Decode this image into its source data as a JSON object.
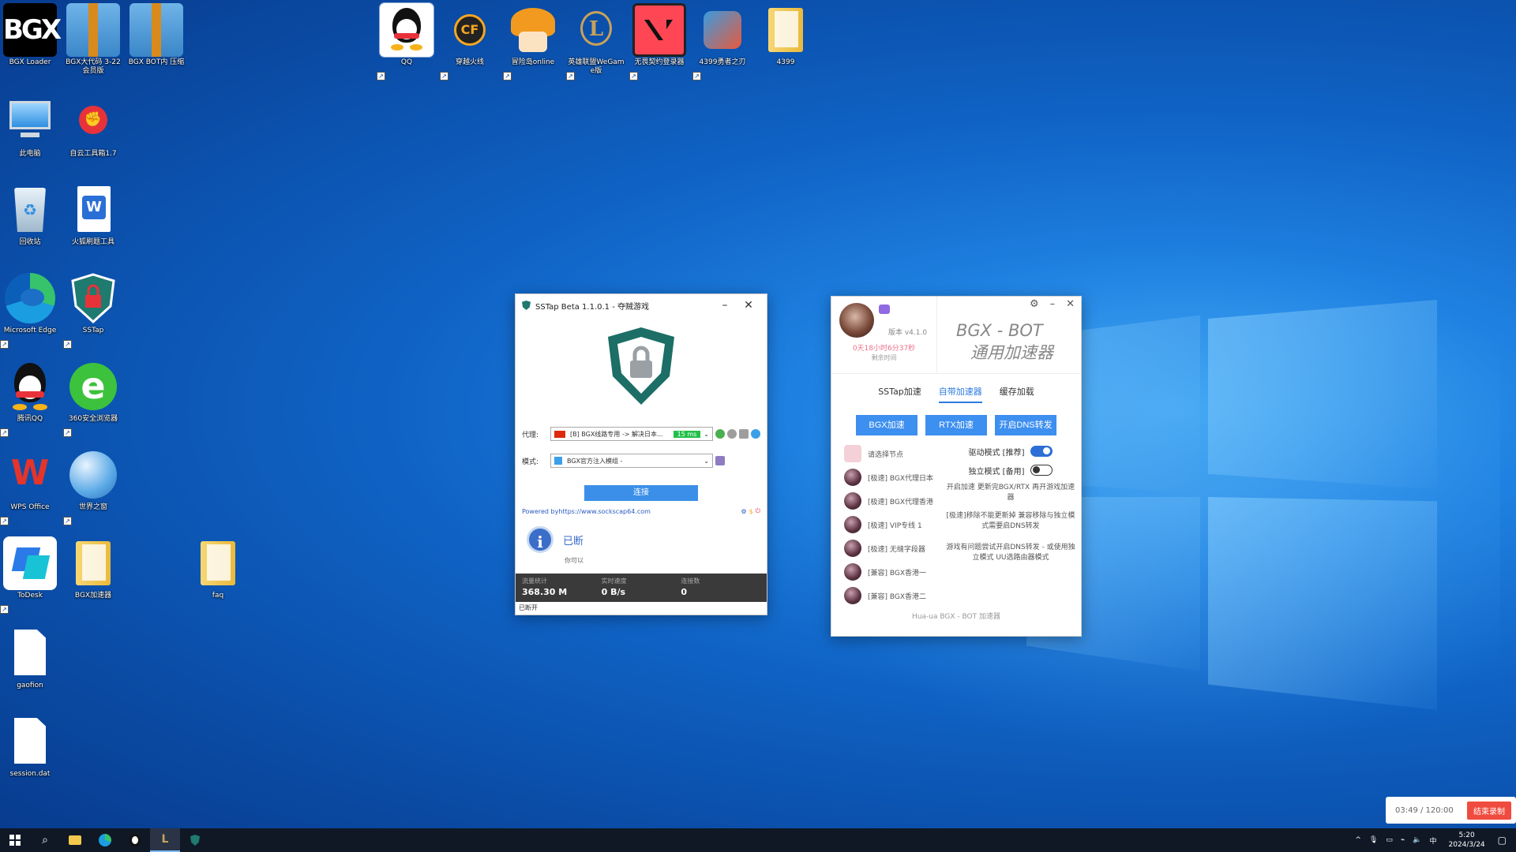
{
  "desktop_icons": [
    {
      "id": "bgx-loader",
      "label": "BGX Loader"
    },
    {
      "id": "bgx-zip1",
      "label": "BGX大代码 3-22 会员版"
    },
    {
      "id": "bgx-zip2",
      "label": "BGX BOT内 压缩"
    },
    {
      "id": "this-pc",
      "label": "此电脑"
    },
    {
      "id": "riot",
      "label": "自云工具箱1.7"
    },
    {
      "id": "recycle",
      "label": "回收站"
    },
    {
      "id": "word",
      "label": "火狐刷题工具"
    },
    {
      "id": "edge",
      "label": "Microsoft Edge"
    },
    {
      "id": "sstap",
      "label": "SSTap"
    },
    {
      "id": "qq-desk",
      "label": "腾讯QQ"
    },
    {
      "id": "ie360",
      "label": "360安全浏览器"
    },
    {
      "id": "wps",
      "label": "WPS Office"
    },
    {
      "id": "world",
      "label": "世界之窗"
    },
    {
      "id": "todesk",
      "label": "ToDesk"
    },
    {
      "id": "bgx-folder",
      "label": "BGX加速器"
    },
    {
      "id": "folder2",
      "label": "faq"
    },
    {
      "id": "gaofion",
      "label": "gaofion"
    },
    {
      "id": "session",
      "label": "session.dat"
    },
    {
      "id": "qq-top",
      "label": "QQ"
    },
    {
      "id": "cf",
      "label": "穿越火线"
    },
    {
      "id": "mxd",
      "label": "冒险岛online"
    },
    {
      "id": "lol",
      "label": "英雄联盟WeGame版"
    },
    {
      "id": "valorant",
      "label": "无畏契约登录器"
    },
    {
      "id": "4399",
      "label": "4399勇者之刃"
    },
    {
      "id": "folder4399",
      "label": "4399"
    }
  ],
  "sstap": {
    "title": "SSTap Beta 1.1.0.1 - 夺贼游戏",
    "proxy_label": "代理:",
    "proxy_value": "[B] BGX线路专用 -> 解决日本...",
    "ping": "15 ms",
    "mode_label": "模式:",
    "mode_value": "BGX官方注入模组 -",
    "connect": "连接",
    "powered_prefix": "Powered by ",
    "powered_link": "https://www.sockscap64.com",
    "status_text": "已断",
    "status_sub": "你可以",
    "stats": [
      {
        "label": "流量统计",
        "value": "368.30 M"
      },
      {
        "label": "实时速度",
        "value": "0 B/s"
      },
      {
        "label": "连接数",
        "value": "0"
      }
    ],
    "footer": "已断开"
  },
  "bgx": {
    "version": "版本 v4.1.0",
    "remaining": "0天18小时6分37秒",
    "remaining_label": "剩余时间",
    "title_line1": "BGX - BOT",
    "title_line2": "通用加速器",
    "tabs": [
      "SSTap加速",
      "自带加速器",
      "缓存加载"
    ],
    "buttons": [
      "BGX加速",
      "RTX加速",
      "开启DNS转发"
    ],
    "nodes": [
      "请选择节点",
      "[极速] BGX代理日本",
      "[极速] BGX代理香港",
      "[极速] VIP专线 1",
      "[极速] 无缝字段器",
      "[兼容] BGX香港一",
      "[兼容] BGX香港二"
    ],
    "driver_mode": "驱动模式 [推荐]",
    "standalone_mode": "独立模式 [备用]",
    "note1": "开启加速 更新完BGX/RTX 再开游戏加速器",
    "note2": "[极速]移除不能更新掉 兼容移除与独立模式需要启DNS转发",
    "note3": "游戏有问题尝试开启DNS转发 - 或使用独立模式 UU选路由器模式",
    "footer": "Hua-ua BGX - BOT 加速器"
  },
  "taskbar": {
    "time": "5:20",
    "date": "2024/3/24"
  },
  "recorder": {
    "time": "03:49 / 120:00",
    "stop": "结束录制"
  }
}
